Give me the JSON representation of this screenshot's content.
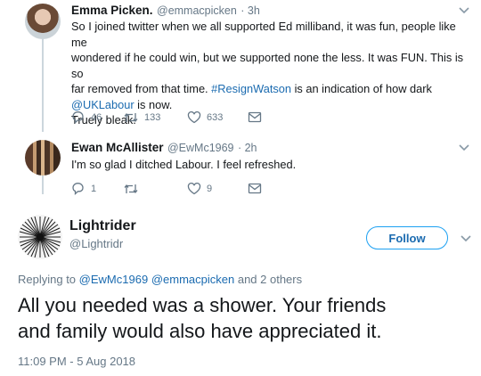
{
  "tweets": [
    {
      "name": "Emma Picken.",
      "handle": "@emmacpicken",
      "time": "3h",
      "lines": [
        "So I joined twitter when we all supported Ed milliband, it was fun, people like me",
        "wondered if he could win, but we supported none the less. It was FUN. This is so"
      ],
      "line3_pre": "far removed from that time. ",
      "hashtag": "#ResignWatson",
      "line3_post": " is an indication of how dark",
      "mention": "@UKLabour",
      "line4_post": " is now.",
      "line5": "Truely bleak.",
      "replies": "46",
      "retweets": "133",
      "likes": "633"
    },
    {
      "name": "Ewan McAllister",
      "handle": "@EwMc1969",
      "time": "2h",
      "text": "I'm so glad I ditched Labour. I feel refreshed.",
      "replies": "1",
      "retweets": "",
      "likes": "9"
    }
  ],
  "main": {
    "name": "Lightrider",
    "handle": "@Lightridr",
    "follow_label": "Follow",
    "replying_prefix": "Replying to",
    "replying_to_1": "@EwMc1969",
    "replying_to_2": "@emmacpicken",
    "replying_suffix": "and 2 others",
    "text_line1": "All you needed was a shower. Your friends",
    "text_line2": "and family would also have appreciated it.",
    "timestamp": "11:09 PM - 5 Aug 2018"
  },
  "icons": {
    "reply": "reply-icon",
    "retweet": "retweet-icon",
    "like": "heart-icon",
    "dm": "envelope-icon",
    "more": "chevron-down-icon"
  },
  "colors": {
    "accent": "#1da1f2",
    "link": "#1b6bb0",
    "muted": "#657786"
  }
}
